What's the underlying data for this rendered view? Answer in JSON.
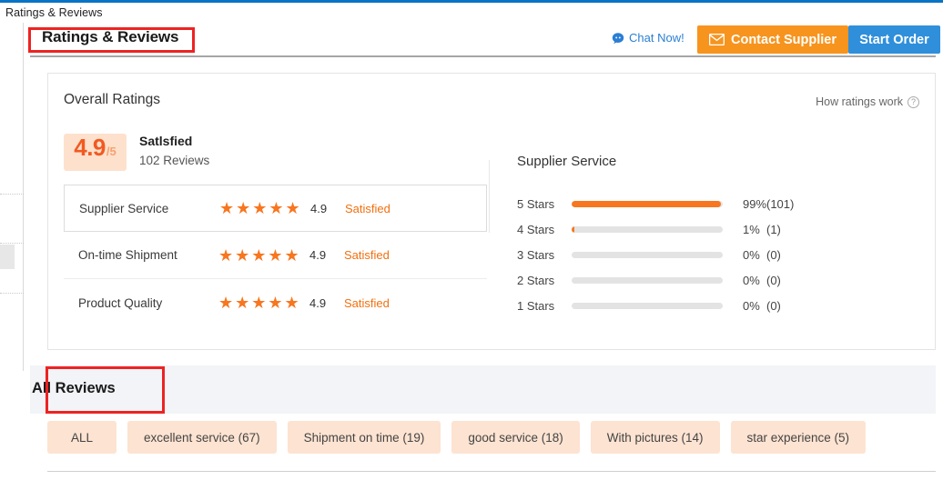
{
  "breadcrumb": "Ratings & Reviews",
  "header": {
    "title": "Ratings & Reviews",
    "chat_label": "Chat Now!",
    "contact_supplier_label": "Contact Supplier",
    "start_order_label": "Start Order",
    "chat_icon": "chat-bubble-icon",
    "envelope_icon": "envelope-icon"
  },
  "overall": {
    "card_title": "Overall Ratings",
    "how_ratings_work": "How ratings work",
    "help_icon": "question-mark-icon",
    "score": "4.9",
    "score_suffix": "/5",
    "score_word": "Satlsfied",
    "review_count": "102 Reviews",
    "metrics": [
      {
        "name": "Supplier Service",
        "stars": "★★★★★",
        "score": "4.9",
        "label": "Satisfied",
        "selected": true
      },
      {
        "name": "On-time Shipment",
        "stars": "★★★★★",
        "score": "4.9",
        "label": "Satisfied",
        "selected": false
      },
      {
        "name": "Product Quality",
        "stars": "★★★★★",
        "score": "4.9",
        "label": "Satisfied",
        "selected": false
      }
    ]
  },
  "distribution": {
    "title": "Supplier Service",
    "rows": [
      {
        "stars": "5  Stars",
        "pct": "99%",
        "count": "(101)",
        "value": 99
      },
      {
        "stars": "4  Stars",
        "pct": "1%",
        "count": "(1)",
        "value": 1
      },
      {
        "stars": "3  Stars",
        "pct": "0%",
        "count": "(0)",
        "value": 0
      },
      {
        "stars": "2  Stars",
        "pct": "0%",
        "count": "(0)",
        "value": 0
      },
      {
        "stars": "1  Stars",
        "pct": "0%",
        "count": "(0)",
        "value": 0
      }
    ]
  },
  "reviews": {
    "band_title": "All Reviews",
    "tags": [
      {
        "label": "ALL"
      },
      {
        "label": "excellent service (67)"
      },
      {
        "label": "Shipment on time (19)"
      },
      {
        "label": "good service (18)"
      },
      {
        "label": "With pictures (14)"
      },
      {
        "label": "star experience (5)"
      }
    ]
  },
  "colors": {
    "accent_orange": "#f7761f",
    "contact_button": "#f7941e",
    "start_button": "#2f8fdb",
    "chat_blue": "#2a7fd4",
    "badge_bg": "#fde1cd",
    "tag_bg": "#fde3d1",
    "band_bg": "#f2f4f7",
    "annotation_red": "#ee2222"
  },
  "chart_data": {
    "type": "bar",
    "title": "Supplier Service",
    "orientation": "horizontal",
    "categories": [
      "5 Stars",
      "4 Stars",
      "3 Stars",
      "2 Stars",
      "1 Stars"
    ],
    "values": [
      99,
      1,
      0,
      0,
      0
    ],
    "counts": [
      101,
      1,
      0,
      0,
      0
    ],
    "value_labels": [
      "99%",
      "1%",
      "0%",
      "0%",
      "0%"
    ],
    "count_labels": [
      "(101)",
      "(1)",
      "(0)",
      "(0)",
      "(0)"
    ],
    "xlabel": "",
    "ylabel": "",
    "xlim": [
      0,
      100
    ],
    "grid": false,
    "legend": null,
    "bar_color": "#f7761f",
    "track_color": "#e3e3e3"
  }
}
